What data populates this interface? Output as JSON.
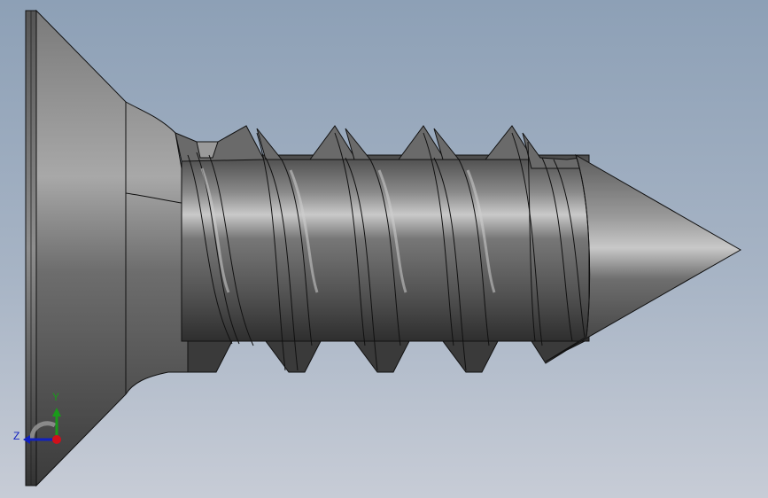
{
  "viewport": {
    "background_top": "#8da0b6",
    "background_bottom": "#c7ccd6"
  },
  "model": {
    "part": "self-tapping-countersunk-screw",
    "body_color": "#5e5e5e"
  },
  "triad": {
    "y_label": "Y",
    "z_label": "Z",
    "x_color": "#d0101a",
    "y_color": "#1a9a1a",
    "z_color": "#1020c0"
  }
}
